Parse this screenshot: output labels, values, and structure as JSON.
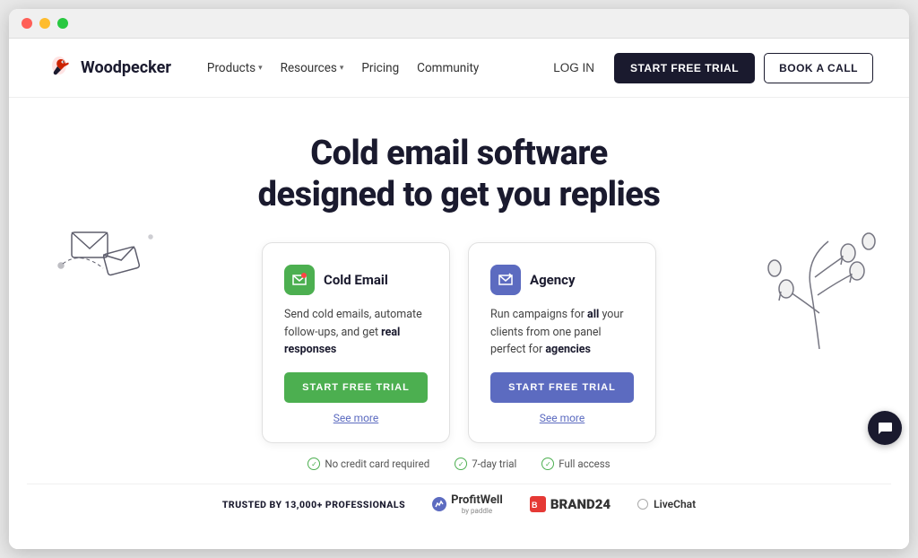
{
  "browser": {
    "traffic_lights": [
      "red",
      "yellow",
      "green"
    ]
  },
  "navbar": {
    "logo_text": "Woodpecker",
    "nav_items": [
      {
        "label": "Products",
        "has_dropdown": true
      },
      {
        "label": "Resources",
        "has_dropdown": true
      },
      {
        "label": "Pricing",
        "has_dropdown": false
      },
      {
        "label": "Community",
        "has_dropdown": false
      }
    ],
    "login_label": "LOG IN",
    "start_trial_label": "START FREE TRIAL",
    "book_call_label": "BOOK A CALL"
  },
  "hero": {
    "title_line1": "Cold email software",
    "title_line2": "designed to get you replies"
  },
  "cards": [
    {
      "id": "cold-email",
      "title": "Cold Email",
      "icon_type": "green",
      "description": "Send cold emails, automate follow-ups, and get real responses",
      "cta_label": "START FREE TRIAL",
      "see_more_label": "See more"
    },
    {
      "id": "agency",
      "title": "Agency",
      "icon_type": "blue",
      "description": "Run campaigns for all your clients from one panel perfect for agencies",
      "cta_label": "START FREE TRIAL",
      "see_more_label": "See more"
    }
  ],
  "info_items": [
    {
      "text": "No credit card required"
    },
    {
      "text": "7-day trial"
    },
    {
      "text": "Full access"
    }
  ],
  "trusted": {
    "label": "TRUSTED BY 13,000+ PROFESSIONALS",
    "brands": [
      {
        "name": "ProfitWell",
        "sub": "by paddle"
      },
      {
        "name": "BRAND24"
      },
      {
        "name": "LiveChat"
      }
    ]
  },
  "chat_btn": "💬"
}
